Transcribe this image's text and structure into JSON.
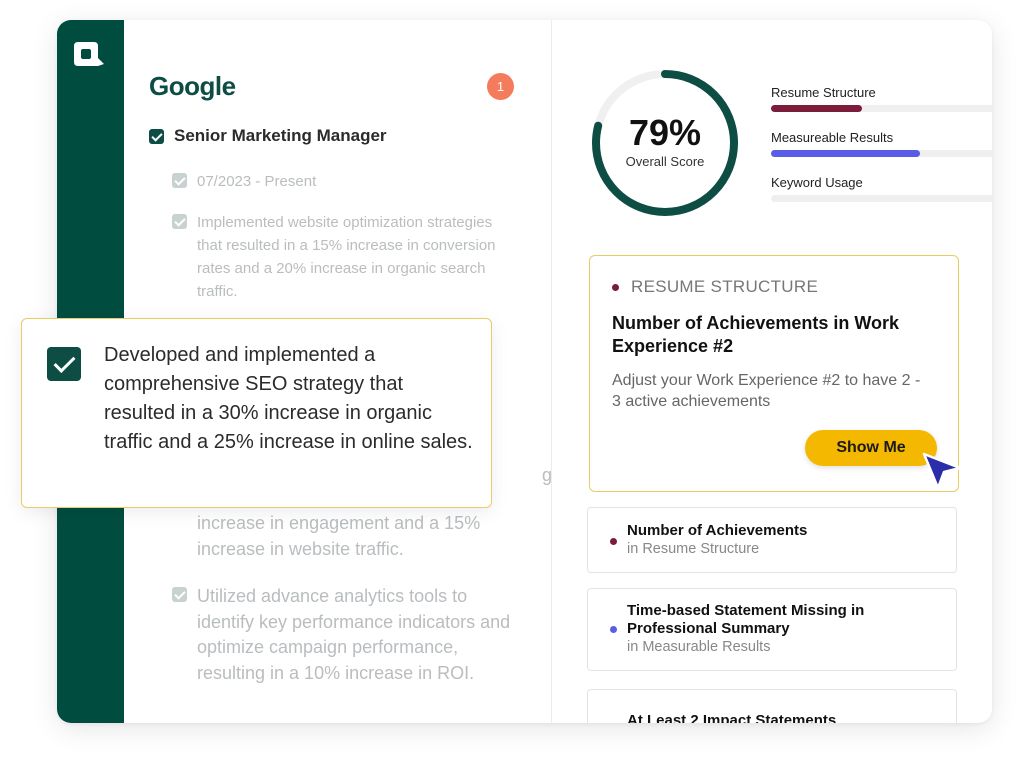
{
  "colors": {
    "brand_dark_green": "#004d40",
    "accent_yellow": "#f5b800",
    "resume_structure": "#7a1c3a",
    "measurable_results": "#5a5ce6",
    "badge_coral": "#f47c5c"
  },
  "icons": {
    "logo": "app-logo-icon",
    "checkbox": "checkbox-checked-icon",
    "cursor": "mouse-pointer-icon"
  },
  "resume": {
    "company": "Google",
    "badge_count": "1",
    "job_title": "Senior Marketing Manager",
    "items": [
      {
        "text": "07/2023 - Present"
      },
      {
        "text": "Implemented website optimization strategies that resulted in a 15% increase in conversion rates and a 20% increase in organic search traffic."
      },
      {
        "text": "g"
      },
      {
        "text": "increase in engagement and a 15% increase in website traffic."
      },
      {
        "text": "Utilized advance analytics tools to identify key performance indicators and optimize campaign performance, resulting in a 10% increase in ROI."
      }
    ],
    "highlighted_item": "Developed and implemented a comprehensive SEO strategy that resulted in a 30% increase in organic traffic and a 25% increase in online sales."
  },
  "score": {
    "value_text": "79%",
    "value": 79,
    "label": "Overall Score"
  },
  "metrics": [
    {
      "label": "Resume Structure",
      "fill": 0.38,
      "color": "#7a1c3a"
    },
    {
      "label": "Measureable Results",
      "fill": 0.62,
      "color": "#5a5ce6"
    },
    {
      "label": "Keyword Usage",
      "fill": 0,
      "color": "#cccccc"
    }
  ],
  "suggestion": {
    "category": "RESUME STRUCTURE",
    "title": "Number of Achievements in Work Experience #2",
    "description": "Adjust your Work Experience #2 to have 2 - 3 active achievements",
    "button_label": "Show Me"
  },
  "suggestion_list": [
    {
      "title": "Number of Achievements",
      "subtitle": "in Resume Structure",
      "dot_color": "#7a1c3a"
    },
    {
      "title": "Time-based Statement Missing in Professional Summary",
      "subtitle": "in Measurable Results",
      "dot_color": "#5a5ce6"
    },
    {
      "title": "At Least 2 Impact Statements",
      "subtitle": "",
      "dot_color": "#7a1c3a"
    }
  ]
}
